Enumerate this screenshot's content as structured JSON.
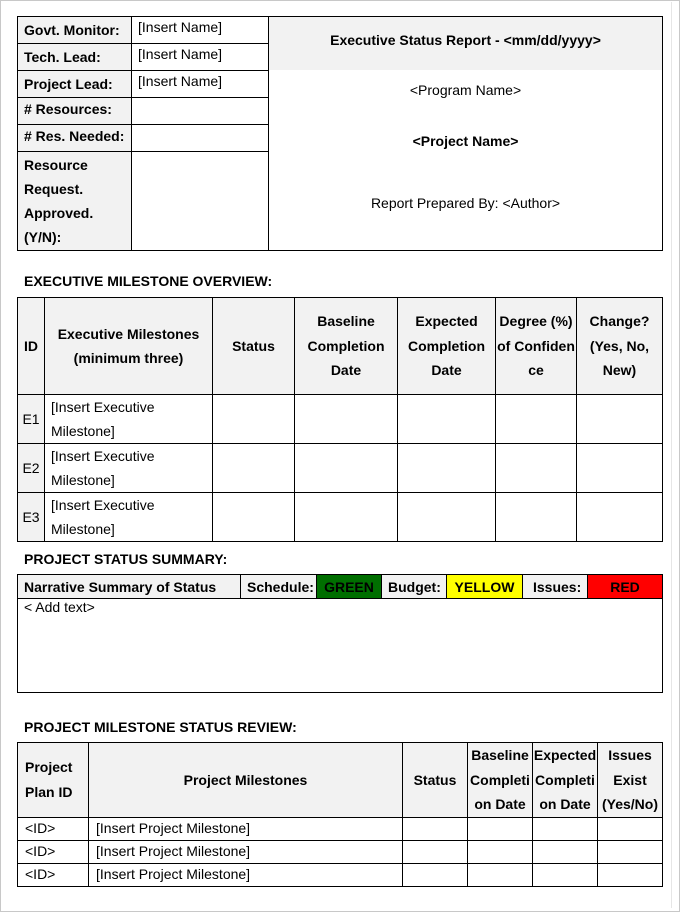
{
  "header": {
    "fields": [
      {
        "label": "Govt. Monitor:",
        "value": "[Insert Name]"
      },
      {
        "label": "Tech. Lead:",
        "value": "[Insert Name]"
      },
      {
        "label": "Project Lead:",
        "value": "[Insert Name]"
      },
      {
        "label": "# Resources:",
        "value": ""
      },
      {
        "label": "# Res. Needed:",
        "value": ""
      },
      {
        "label": "Resource Request. Approved. (Y/N):",
        "value": ""
      }
    ],
    "title": "Executive Status Report - <mm/dd/yyyy>",
    "program_name": "<Program Name>",
    "project_name": "<Project Name>",
    "prepared_by": "Report Prepared By: <Author>"
  },
  "exec_overview": {
    "heading": "EXECUTIVE MILESTONE OVERVIEW:",
    "columns": [
      "ID",
      "Executive Milestones (minimum three)",
      "Status",
      "Baseline Completion Date",
      "Expected Completion Date",
      "Degree (%) of Confidence",
      "Change? (Yes, No, New)"
    ],
    "rows": [
      {
        "id": "E1",
        "milestone": "[Insert Executive Milestone]"
      },
      {
        "id": "E2",
        "milestone": "[Insert Executive Milestone]"
      },
      {
        "id": "E3",
        "milestone": "[Insert Executive Milestone]"
      }
    ]
  },
  "status_summary": {
    "heading": "PROJECT STATUS SUMMARY:",
    "narrative_label": "Narrative Summary of Status",
    "schedule_label": "Schedule:",
    "schedule_value": "GREEN",
    "budget_label": "Budget:",
    "budget_value": "YELLOW",
    "issues_label": "Issues:",
    "issues_value": "RED",
    "body": "< Add text>",
    "colors": {
      "green": "#006e00",
      "yellow": "#ffff00",
      "red": "#ff0000"
    }
  },
  "milestone_review": {
    "heading": "PROJECT MILESTONE STATUS REVIEW:",
    "columns": [
      "Project Plan ID",
      "Project Milestones",
      "Status",
      "Baseline Completion Date",
      "Expected Completion Date",
      "Issues Exist (Yes/No)"
    ],
    "rows": [
      {
        "id": "<ID>",
        "milestone": "[Insert Project Milestone]"
      },
      {
        "id": "<ID>",
        "milestone": "[Insert Project Milestone]"
      },
      {
        "id": "<ID>",
        "milestone": "[Insert Project Milestone]"
      }
    ]
  }
}
